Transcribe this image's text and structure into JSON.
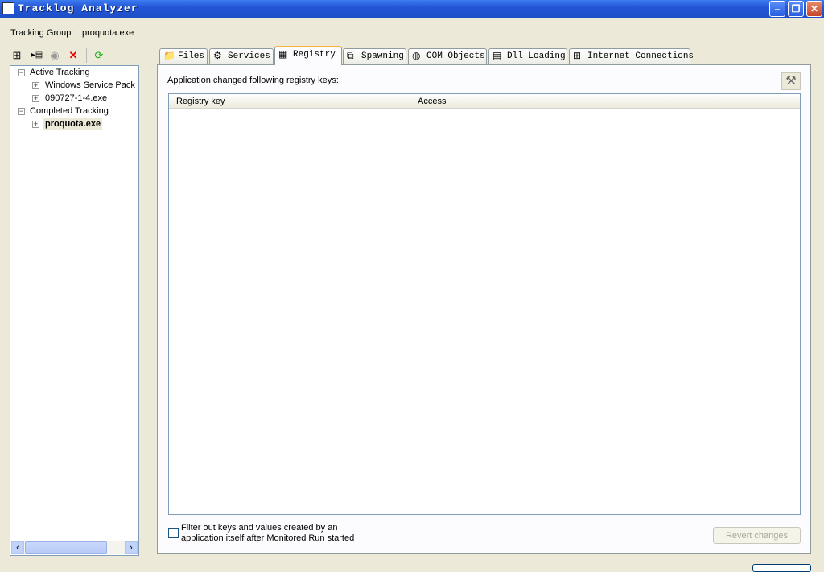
{
  "window": {
    "title": "Tracklog Analyzer",
    "minimize": "–",
    "restore": "❐",
    "close": "✕"
  },
  "group": {
    "label": "Tracking Group:",
    "value": "proquota.exe"
  },
  "toolbar": [
    {
      "name": "tree-view-icon",
      "glyph": "⊞"
    },
    {
      "name": "list-view-icon",
      "glyph": "▸▤"
    },
    {
      "name": "stop-icon",
      "glyph": "◉"
    },
    {
      "name": "delete-icon",
      "glyph": "✕"
    },
    {
      "name": "refresh-icon",
      "glyph": "⟳"
    }
  ],
  "tree": {
    "active": "Active Tracking",
    "active_items": [
      "Windows Service Pack",
      "090727-1-4.exe"
    ],
    "completed": "Completed Tracking",
    "completed_items": [
      "proquota.exe"
    ]
  },
  "tabs": [
    {
      "label": "Files",
      "icon": "📁"
    },
    {
      "label": "Services",
      "icon": "⚙"
    },
    {
      "label": "Registry",
      "icon": "▦"
    },
    {
      "label": "Spawning",
      "icon": "⧉"
    },
    {
      "label": "COM Objects",
      "icon": "◍"
    },
    {
      "label": "Dll Loading",
      "icon": "▤"
    },
    {
      "label": "Internet Connections",
      "icon": "⊞"
    }
  ],
  "registry": {
    "caption": "Application changed following registry keys:",
    "columns": [
      "Registry key",
      "Access"
    ],
    "filter": "Filter out keys and values created by an application itself after Monitored Run started",
    "revert": "Revert changes",
    "tools_glyph": "⚒"
  }
}
